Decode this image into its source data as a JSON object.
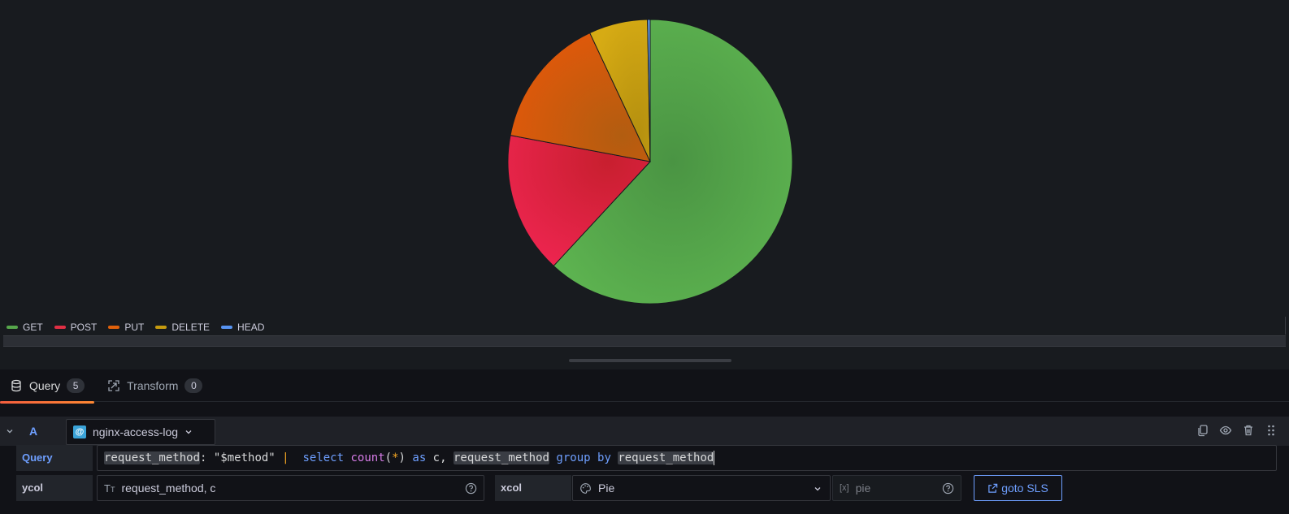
{
  "chart_data": {
    "type": "pie",
    "categories": [
      "GET",
      "POST",
      "PUT",
      "DELETE",
      "HEAD"
    ],
    "values": [
      612,
      159,
      149,
      66,
      3
    ],
    "colors": [
      "#56a64b",
      "#e02f44",
      "#e0610b",
      "#c69b0f",
      "#5794f2"
    ],
    "legend_placement": "bottom-left"
  },
  "editor": {
    "tabs": [
      {
        "label": "Query",
        "count": "5",
        "icon": "database-icon"
      },
      {
        "label": "Transform",
        "count": "0",
        "icon": "transform-icon"
      }
    ],
    "query": {
      "ref_id": "A",
      "datasource": "nginx-access-log",
      "query_label": "Query",
      "query_text": {
        "t1": "request_method",
        "t2": ": \"$method\" ",
        "t3": "|",
        "t4": "select",
        "t5": "count",
        "t6": "(",
        "t7": "*",
        "t8": ")",
        "t9": "as",
        "t10": " c, ",
        "t11": "request_method",
        "t12": "group",
        "t13": "by",
        "t14": "request_method"
      },
      "ycol_label": "ycol",
      "ycol_value": "request_method, c",
      "xcol_label": "xcol",
      "xcol_value": "Pie",
      "variable_placeholder": "pie",
      "goto_label": "goto SLS"
    }
  }
}
